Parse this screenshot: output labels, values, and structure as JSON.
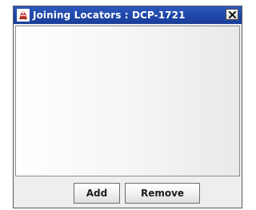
{
  "window": {
    "title": "Joining Locators : DCP-1721",
    "app_icon": "java-duke-icon",
    "close_icon": "close-icon"
  },
  "buttons": {
    "add_label": "Add",
    "remove_label": "Remove"
  },
  "colors": {
    "titlebar": "#2e59bf",
    "title_text": "#ffffff",
    "window_bg": "#eeeeee"
  }
}
